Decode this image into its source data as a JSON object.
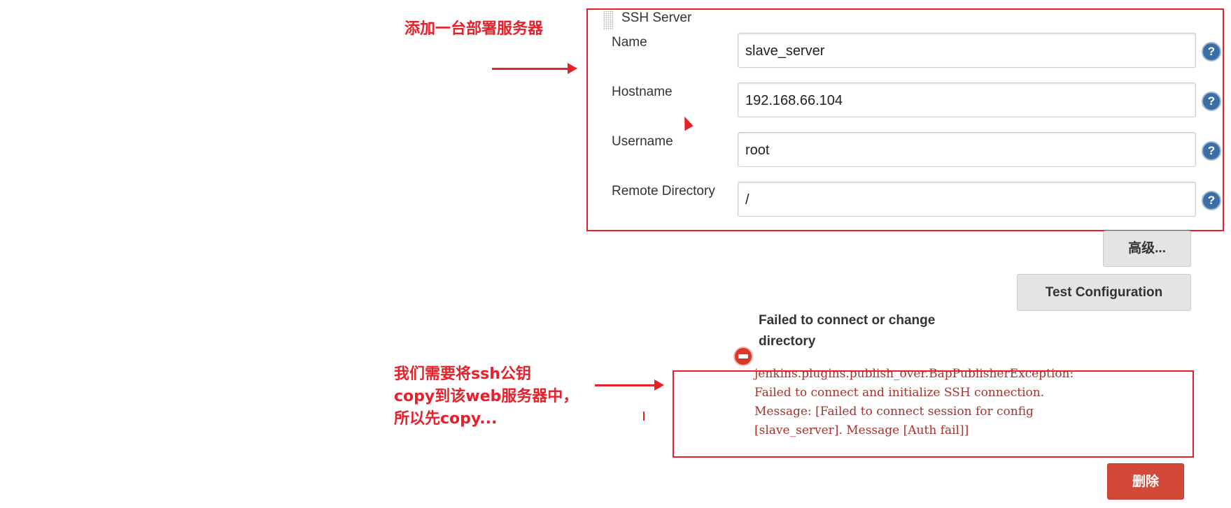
{
  "annotations": {
    "top_note": "添加一台部署服务器",
    "bottom_note": [
      "我们需要将ssh公钥",
      "copy到该web服务器中，",
      "所以先copy..."
    ]
  },
  "ssh_server": {
    "section_title": "SSH Server",
    "fields": [
      {
        "label": "Name",
        "value": "slave_server"
      },
      {
        "label": "Hostname",
        "value": "192.168.66.104"
      },
      {
        "label": "Username",
        "value": "root"
      },
      {
        "label": "Remote Directory",
        "value": "/"
      }
    ],
    "help_glyph": "?",
    "advanced_label": "高级...",
    "test_label": "Test Configuration",
    "delete_label": "删除"
  },
  "error": {
    "title_lines": [
      "Failed to connect or change",
      "directory"
    ],
    "message_lines": [
      "jenkins.plugins.publish_over.BapPublisherException:",
      "Failed to connect and initialize SSH connection.",
      "Message: [Failed to connect session for config",
      "[slave_server]. Message [Auth fail]]"
    ]
  },
  "colors": {
    "annotation": "#e8202a",
    "delete_button": "#d24939",
    "error_text": "#a8322b"
  }
}
